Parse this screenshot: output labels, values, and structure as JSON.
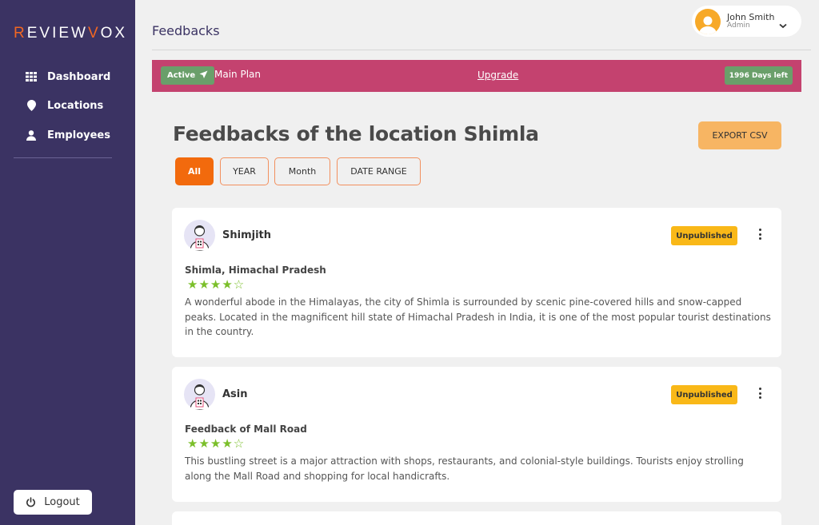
{
  "app": {
    "brand_first": "R",
    "brand_mid": "EVIEW",
    "brand_v": "V",
    "brand_end": "OX"
  },
  "sidebar": {
    "items": [
      {
        "label": "Dashboard",
        "icon": "grid-icon"
      },
      {
        "label": "Locations",
        "icon": "location-pin-icon"
      },
      {
        "label": "Employees",
        "icon": "person-icon"
      }
    ],
    "logout_label": "Logout"
  },
  "header": {
    "title": "Feedbacks",
    "user_name": "John Smith",
    "user_role": "Admin"
  },
  "plan": {
    "status": "Active",
    "name": "Main Plan",
    "upgrade_label": "Upgrade",
    "days_left": "1996 Days left"
  },
  "main": {
    "heading": "Feedbacks of the location Shimla",
    "export_label": "EXPORT CSV",
    "filters": [
      "All",
      "YEAR",
      "Month",
      "DATE RANGE"
    ]
  },
  "feedbacks": [
    {
      "name": "Shimjith",
      "status": "Unpublished",
      "title": "Shimla, Himachal Pradesh",
      "rating": 4,
      "rating_max": 5,
      "stars": "★★★★☆",
      "text": "A wonderful abode in the Himalayas, the city of Shimla is surrounded by scenic pine-covered hills and snow-capped peaks. Located in the magnificent hill state of Himachal Pradesh in India, it is one of the most popular tourist destinations in the country."
    },
    {
      "name": "Asin",
      "status": "Unpublished",
      "title": "Feedback of Mall Road",
      "rating": 4,
      "rating_max": 5,
      "stars": "★★★★☆",
      "text": "This bustling street is a major attraction with shops, restaurants, and colonial-style buildings. Tourists enjoy strolling along the Mall Road and shopping for local handicrafts."
    }
  ],
  "colors": {
    "sidebar": "#3b3363",
    "accent": "#f26a0d",
    "plan_banner": "#c4426f",
    "badge_green": "#6a9f6a",
    "unpublished": "#f9b818",
    "stars": "#7bbf2a"
  }
}
